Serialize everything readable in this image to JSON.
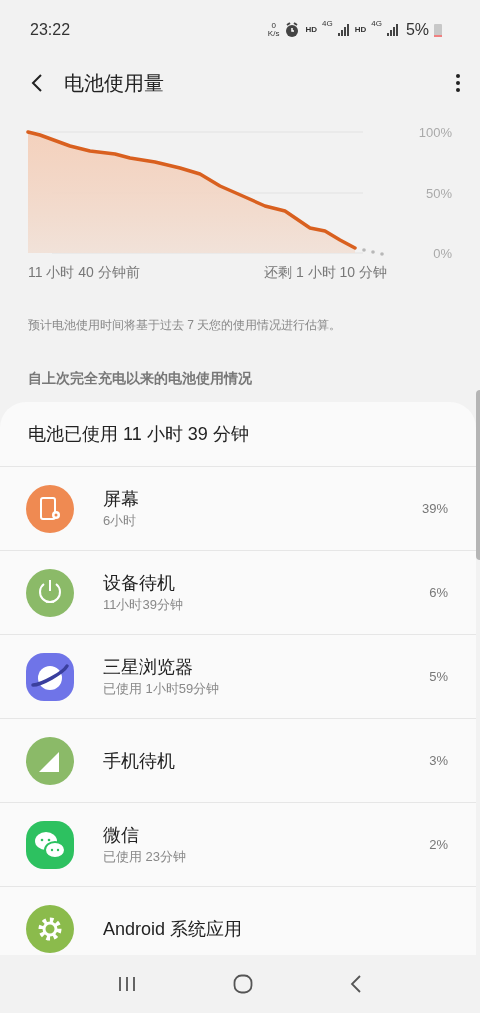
{
  "status_bar": {
    "time": "23:22",
    "net_speed": {
      "value": "0",
      "unit": "K/s"
    },
    "sim_slots": [
      {
        "hd": "HD",
        "network": "4G"
      },
      {
        "hd": "HD",
        "network": "4G"
      }
    ],
    "battery": "5%"
  },
  "header": {
    "title": "电池使用量"
  },
  "usage_chart": {
    "y_labels": [
      "100%",
      "50%",
      "0%"
    ],
    "start_label": "11 小时 40 分钟前",
    "end_label": "还剩 1 小时 10 分钟"
  },
  "note": "预计电池使用时间将基于过去 7 天您的使用情况进行估算。",
  "section_title": "自上次完全充电以来的电池使用情况",
  "usage_card": {
    "title": "电池已使用 11 小时 39 分钟",
    "rows": [
      {
        "name": "屏幕",
        "detail": "6小时",
        "percent": "39%"
      },
      {
        "name": "设备待机",
        "detail": "11小时39分钟",
        "percent": "6%"
      },
      {
        "name": "三星浏览器",
        "detail": "已使用 1小时59分钟",
        "percent": "5%"
      },
      {
        "name": "手机待机",
        "percent": "3%"
      },
      {
        "name": "微信",
        "detail": "已使用 23分钟",
        "percent": "2%"
      },
      {
        "name": "Android 系统应用"
      }
    ]
  }
}
